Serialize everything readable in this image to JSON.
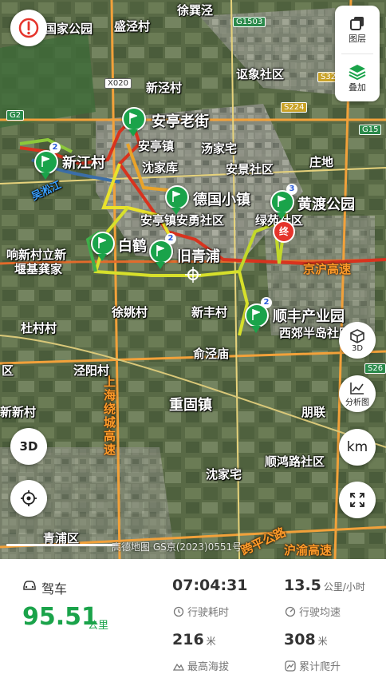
{
  "map": {
    "places": {
      "xujingtu": "徐巽泾",
      "shengjingcun": "盛泾村",
      "xinjingcun": "新泾村",
      "shengjiashezhu": "讴象社区",
      "anting_laojie": "安亭老街",
      "anting_zhen": "安亭镇",
      "tangjiazhai": "汤家宅",
      "anjing_shequ": "安景社区",
      "zhuangjia": "庄地",
      "xinjiangcun": "新江村",
      "shenjiaku": "沈家库",
      "deguo_xiaozhen": "德国小镇",
      "huangdu_gongyuan": "黄渡公园",
      "anyong_shequ": "安亭镇安勇社区",
      "lvyuan_shequ": "绿苑社区",
      "wusongjiang": "吴淞江",
      "xiang_xincun": "响新村立新",
      "yanjiyanjia": "堰基龚家",
      "baihe": "白鹤",
      "jiuqingpu": "旧青浦",
      "jinghu_gaosu": "京沪高速",
      "xuyaocun": "徐姚村",
      "xinfengcun": "新丰村",
      "shunfeng_yuan": "顺丰产业园",
      "xijiao_shequ": "西郊半岛社区",
      "dulincun": "杜村村",
      "yujingmiao": "俞泾庙",
      "jingyangcun": "泾阳村",
      "shanghai_raocheng": "上海绕城高速",
      "chonggu_zhen": "重固镇",
      "pengliancun": "朋联",
      "xinfangcun": "新新村",
      "shunhong_shequ": "顺鸿路社区",
      "shenjiazhai": "沈家宅",
      "qingpu_qu": "青浦区",
      "huyu_gaosu": "沪渝高速",
      "yangping_gonglu": "跨平公路",
      "gongyuan_top": "国家公园",
      "xiangqu": "区"
    },
    "shields": [
      "G1503",
      "X020",
      "S224",
      "S32",
      "G15",
      "G2",
      "S26"
    ],
    "watermark": "高德地图 GS京(2023)0551号",
    "end_marker": "终",
    "pin_badges": [
      "2",
      "2",
      "3",
      "2"
    ],
    "accent_green": "#1aa34a"
  },
  "controls": {
    "layers_label": "图层",
    "overlay_label": "叠加",
    "btn_3d_label": "3D",
    "btn_analysis_label": "分析图",
    "btn_unit_label": "km",
    "btn_3d_left_label": "3D"
  },
  "stats": {
    "mode_label": "驾车",
    "distance_value": "95.51",
    "distance_unit": "公里",
    "duration_value": "07:04:31",
    "duration_label": "行驶耗时",
    "avg_speed_value": "13.5",
    "avg_speed_unit": "公里/小时",
    "avg_speed_label": "行驶均速",
    "max_alt_value": "216",
    "max_alt_unit": "米",
    "max_alt_label": "最高海拔",
    "climb_value": "308",
    "climb_unit": "米",
    "climb_label": "累计爬升"
  }
}
